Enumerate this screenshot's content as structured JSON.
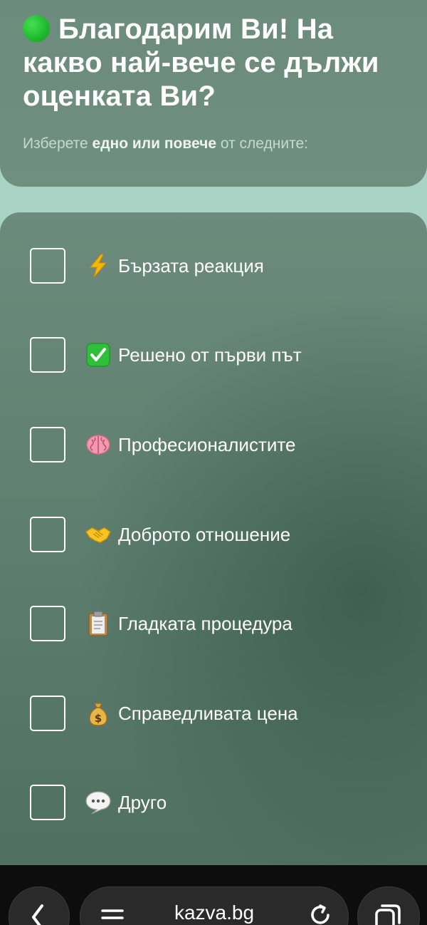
{
  "header": {
    "title": "Благодарим Ви! На какво най-вече се дължи оценката Ви?",
    "subtitle_prefix": "Изберете ",
    "subtitle_bold": "едно или повече",
    "subtitle_suffix": " от следните:"
  },
  "options": [
    {
      "label": "Бързата реакция",
      "icon": "lightning-icon",
      "checked": false
    },
    {
      "label": "Решено от първи път",
      "icon": "check-mark-button-icon",
      "checked": false
    },
    {
      "label": "Професионалистите",
      "icon": "brain-icon",
      "checked": false
    },
    {
      "label": "Доброто отношение",
      "icon": "handshake-icon",
      "checked": false
    },
    {
      "label": "Гладката процедура",
      "icon": "clipboard-icon",
      "checked": false
    },
    {
      "label": "Справедливата цена",
      "icon": "money-bag-icon",
      "checked": false
    },
    {
      "label": "Друго",
      "icon": "speech-bubble-icon",
      "checked": false
    }
  ],
  "browser": {
    "url": "kazva.bg",
    "icons": [
      "back-icon",
      "menu-icon",
      "reload-icon",
      "tabs-icon"
    ]
  },
  "colors": {
    "accent_green": "#1eb82c",
    "card_bg": "#6c8b7c",
    "page_bg": "#a9d3c4",
    "browser_bar": "#0d0d0d"
  }
}
